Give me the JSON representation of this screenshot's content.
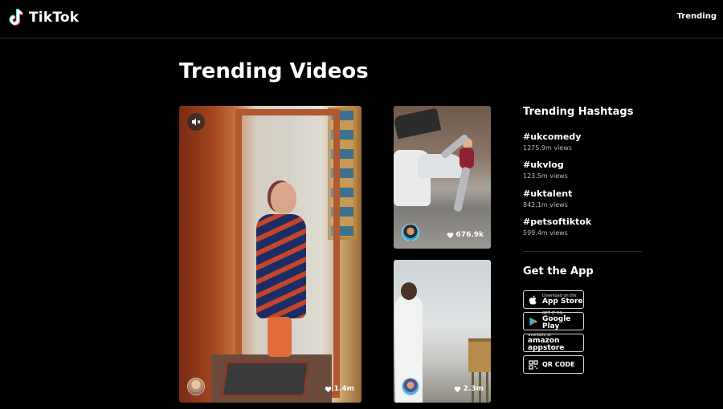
{
  "header": {
    "logo_text": "TikTok",
    "nav_trending": "Trending"
  },
  "page": {
    "title": "Trending Videos"
  },
  "videos": [
    {
      "likes": "1.4m",
      "muted": true,
      "icon": "heart-icon"
    },
    {
      "likes": "676.9k",
      "icon": "heart-icon"
    },
    {
      "likes": "2.3m",
      "icon": "heart-icon"
    }
  ],
  "sidebar": {
    "hashtags_heading": "Trending Hashtags",
    "hashtags": [
      {
        "tag": "#ukcomedy",
        "views": "1275.9m views"
      },
      {
        "tag": "#ukvlog",
        "views": "123.5m views"
      },
      {
        "tag": "#uktalent",
        "views": "842.1m views"
      },
      {
        "tag": "#petsoftiktok",
        "views": "599.4m views"
      }
    ],
    "get_app_heading": "Get the App",
    "app_buttons": {
      "app_store": {
        "small": "Download on the",
        "big": "App Store",
        "icon": "apple-icon"
      },
      "google_play": {
        "small": "GET IT ON",
        "big": "Google Play",
        "icon": "google-play-icon"
      },
      "amazon": {
        "small": "available at",
        "big": "amazon appstore",
        "icon": "amazon-icon"
      },
      "qr": {
        "big": "QR CODE",
        "icon": "qr-code-icon"
      }
    }
  },
  "colors": {
    "background": "#000000",
    "text": "#ffffff",
    "muted_text": "#b7b7b7",
    "logo_cyan": "#25f4ee",
    "logo_red": "#fe2c55"
  }
}
